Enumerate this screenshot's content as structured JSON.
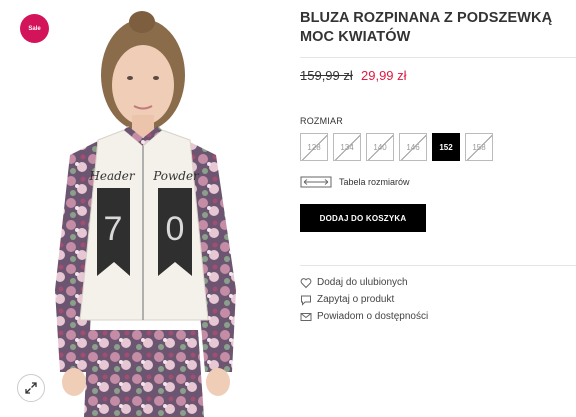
{
  "product": {
    "title_line1": "BLUZA ROZPINANA Z PODSZEWKĄ",
    "title_line2": "MOC KWIATÓW",
    "price_old": "159,99 zł",
    "price_new": "29,99 zł"
  },
  "badge": {
    "label": "Sale",
    "color": "#d4145a"
  },
  "sizes": {
    "label": "ROZMIAR",
    "options": [
      {
        "label": "128",
        "available": false
      },
      {
        "label": "134",
        "available": false
      },
      {
        "label": "140",
        "available": false
      },
      {
        "label": "146",
        "available": false
      },
      {
        "label": "152",
        "available": true,
        "selected": true
      },
      {
        "label": "158",
        "available": false
      }
    ]
  },
  "size_table": {
    "label": "Tabela rozmiarów",
    "icon": "ruler-icon"
  },
  "cart": {
    "button_label": "DODAJ DO KOSZYKA"
  },
  "actions": [
    {
      "label": "Dodaj do ulubionych",
      "icon": "heart-icon"
    },
    {
      "label": "Zapytaj o produkt",
      "icon": "speech-bubble-icon"
    },
    {
      "label": "Powiadom o dostępności",
      "icon": "envelope-icon"
    }
  ],
  "gallery": {
    "jacket_print_left": "Header",
    "jacket_print_right": "Powder",
    "jacket_number_left": "7",
    "jacket_number_right": "0",
    "zoom_icon": "expand-icon"
  },
  "colors": {
    "accent_red": "#e1173f",
    "button_black": "#000000"
  }
}
